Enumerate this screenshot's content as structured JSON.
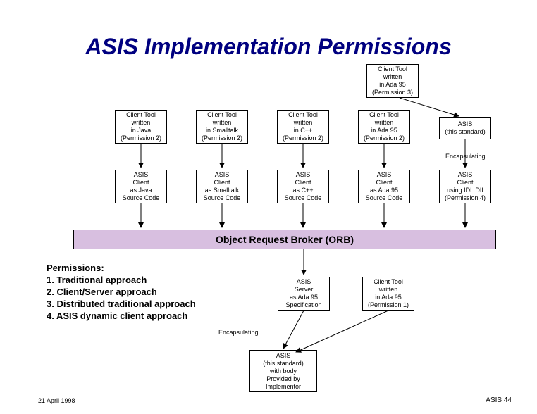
{
  "title": "ASIS Implementation Permissions",
  "top_box": {
    "l1": "Client Tool",
    "l2": "written",
    "l3": "in Ada 95",
    "l4": "(Permission 3)"
  },
  "row1": [
    {
      "l1": "Client Tool",
      "l2": "written",
      "l3": "in Java",
      "l4": "(Permission 2)"
    },
    {
      "l1": "Client Tool",
      "l2": "written",
      "l3": "in Smalltalk",
      "l4": "(Permission 2)"
    },
    {
      "l1": "Client Tool",
      "l2": "written",
      "l3": "in C++",
      "l4": "(Permission 2)"
    },
    {
      "l1": "Client Tool",
      "l2": "written",
      "l3": "in Ada 95",
      "l4": "(Permission 2)"
    },
    {
      "l1": "ASIS",
      "l2": "(this standard)",
      "l3": "",
      "l4": ""
    }
  ],
  "encapsulating": "Encapsulating",
  "row2": [
    {
      "l1": "ASIS",
      "l2": "Client",
      "l3": "as Java",
      "l4": "Source Code"
    },
    {
      "l1": "ASIS",
      "l2": "Client",
      "l3": "as Smalltalk",
      "l4": "Source Code"
    },
    {
      "l1": "ASIS",
      "l2": "Client",
      "l3": "as C++",
      "l4": "Source Code"
    },
    {
      "l1": "ASIS",
      "l2": "Client",
      "l3": "as Ada 95",
      "l4": "Source Code"
    },
    {
      "l1": "ASIS",
      "l2": "Client",
      "l3": "using IDL DII",
      "l4": "(Permission 4)"
    }
  ],
  "orb": "Object Request Broker (ORB)",
  "permissions": {
    "title": "Permissions:",
    "items": [
      "1.  Traditional approach",
      "2.  Client/Server approach",
      "3.  Distributed traditional approach",
      "4.  ASIS dynamic client approach"
    ]
  },
  "bottom_boxes": [
    {
      "l1": "ASIS",
      "l2": "Server",
      "l3": "as Ada 95",
      "l4": "Specification"
    },
    {
      "l1": "Client Tool",
      "l2": "written",
      "l3": "in Ada 95",
      "l4": "(Permission 1)"
    }
  ],
  "bottom_center": {
    "l1": "ASIS",
    "l2": "(this standard)",
    "l3": "with body",
    "l4": "Provided by",
    "l5": "Implementor"
  },
  "footer": {
    "left": "21 April 1998",
    "right": "ASIS 44"
  },
  "chart_data": {
    "type": "diagram",
    "title": "ASIS Implementation Permissions",
    "nodes": [
      {
        "id": "ct_ada95_p3",
        "label": "Client Tool written in Ada 95 (Permission 3)"
      },
      {
        "id": "ct_java_p2",
        "label": "Client Tool written in Java (Permission 2)"
      },
      {
        "id": "ct_smalltalk_p2",
        "label": "Client Tool written in Smalltalk (Permission 2)"
      },
      {
        "id": "ct_cpp_p2",
        "label": "Client Tool written in C++ (Permission 2)"
      },
      {
        "id": "ct_ada95_p2",
        "label": "Client Tool written in Ada 95 (Permission 2)"
      },
      {
        "id": "asis_std_top",
        "label": "ASIS (this standard)"
      },
      {
        "id": "asis_java",
        "label": "ASIS Client as Java Source Code"
      },
      {
        "id": "asis_smalltalk",
        "label": "ASIS Client as Smalltalk Source Code"
      },
      {
        "id": "asis_cpp",
        "label": "ASIS Client as C++ Source Code"
      },
      {
        "id": "asis_ada95",
        "label": "ASIS Client as Ada 95 Source Code"
      },
      {
        "id": "asis_idl",
        "label": "ASIS Client using IDL DII (Permission 4)"
      },
      {
        "id": "orb",
        "label": "Object Request Broker (ORB)"
      },
      {
        "id": "asis_server",
        "label": "ASIS Server as Ada 95 Specification"
      },
      {
        "id": "ct_ada95_p1",
        "label": "Client Tool written in Ada 95 (Permission 1)"
      },
      {
        "id": "asis_std_bottom",
        "label": "ASIS (this standard) with body Provided by Implementor"
      }
    ],
    "edges": [
      {
        "from": "ct_ada95_p3",
        "to": "asis_std_top",
        "label": ""
      },
      {
        "from": "ct_java_p2",
        "to": "asis_java",
        "label": ""
      },
      {
        "from": "ct_smalltalk_p2",
        "to": "asis_smalltalk",
        "label": ""
      },
      {
        "from": "ct_cpp_p2",
        "to": "asis_cpp",
        "label": ""
      },
      {
        "from": "ct_ada95_p2",
        "to": "asis_ada95",
        "label": ""
      },
      {
        "from": "asis_std_top",
        "to": "asis_idl",
        "label": "Encapsulating"
      },
      {
        "from": "asis_java",
        "to": "orb",
        "label": ""
      },
      {
        "from": "asis_smalltalk",
        "to": "orb",
        "label": ""
      },
      {
        "from": "asis_cpp",
        "to": "orb",
        "label": ""
      },
      {
        "from": "asis_ada95",
        "to": "orb",
        "label": ""
      },
      {
        "from": "asis_idl",
        "to": "orb",
        "label": ""
      },
      {
        "from": "orb",
        "to": "asis_server",
        "label": ""
      },
      {
        "from": "asis_server",
        "to": "asis_std_bottom",
        "label": "Encapsulating"
      },
      {
        "from": "ct_ada95_p1",
        "to": "asis_std_bottom",
        "label": ""
      }
    ],
    "permissions_list": [
      "Traditional approach",
      "Client/Server approach",
      "Distributed traditional approach",
      "ASIS dynamic client approach"
    ]
  }
}
